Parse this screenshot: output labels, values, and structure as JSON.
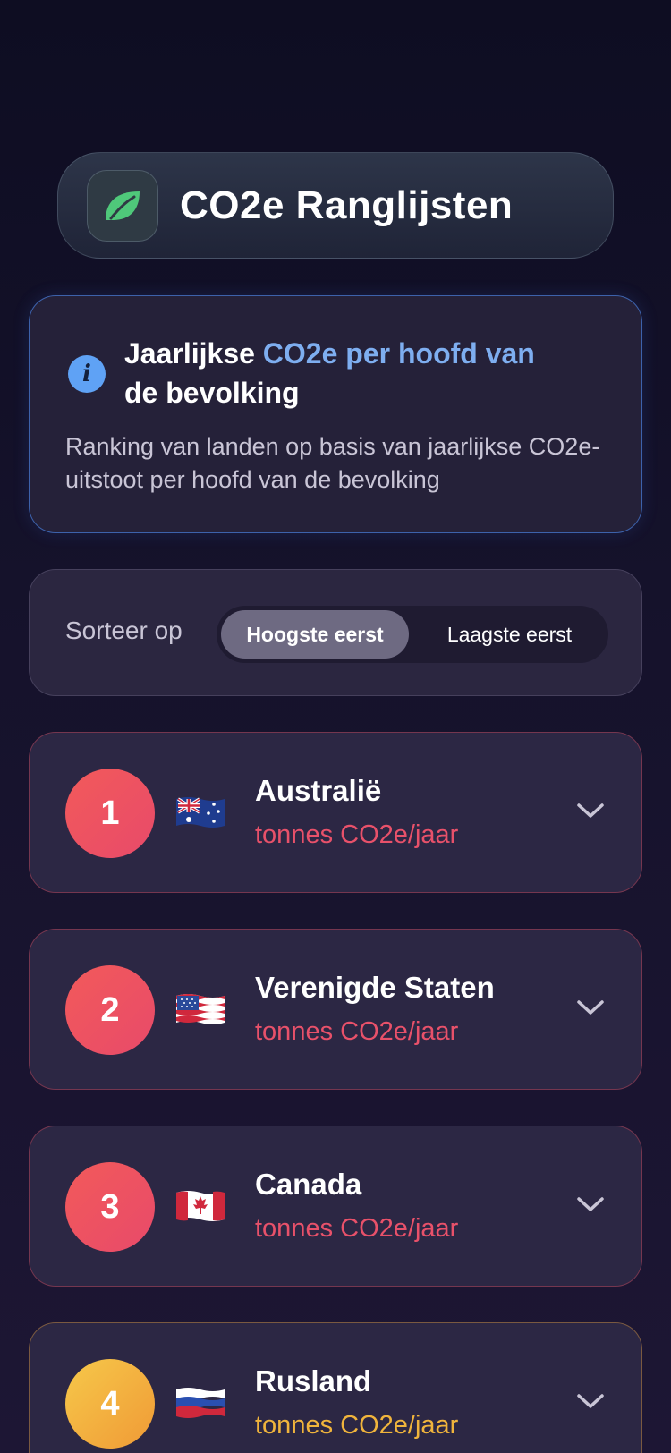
{
  "header": {
    "title": "CO2e Ranglijsten",
    "icon": "leaf-icon",
    "icon_color": "#4fc87a"
  },
  "info": {
    "title_prefix": "Jaarlijkse ",
    "title_accent": "CO2e per hoofd van",
    "title_suffix": "de bevolking",
    "description": "Ranking van landen op basis van jaarlijkse CO2e-uitstoot per hoofd van de bevolking",
    "accent_color": "#7eaef0"
  },
  "sort": {
    "label": "Sorteer op",
    "options": [
      "Hoogste eerst",
      "Laagste eerst"
    ],
    "selected": "Hoogste eerst"
  },
  "rankings": [
    {
      "rank": "1",
      "country": "Australië",
      "flag": "australia-flag-icon",
      "unit": "tonnes CO2e/jaar",
      "color": "#e8516a"
    },
    {
      "rank": "2",
      "country": "Verenigde Staten",
      "flag": "united-states-flag-icon",
      "unit": "tonnes CO2e/jaar",
      "color": "#e8516a"
    },
    {
      "rank": "3",
      "country": "Canada",
      "flag": "canada-flag-icon",
      "unit": "tonnes CO2e/jaar",
      "color": "#e8516a"
    },
    {
      "rank": "4",
      "country": "Rusland",
      "flag": "russia-flag-icon",
      "unit": "tonnes CO2e/jaar",
      "color": "#f0b43c"
    }
  ]
}
